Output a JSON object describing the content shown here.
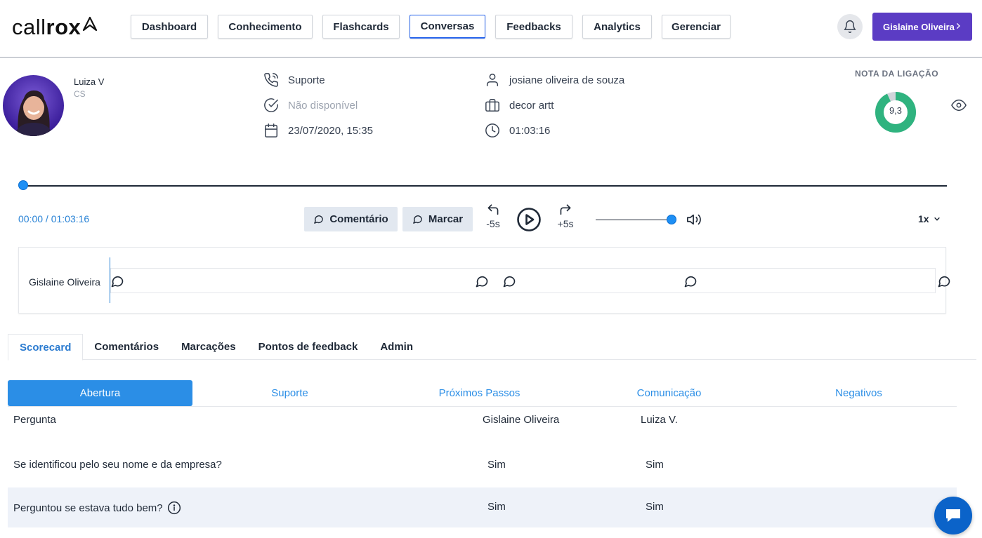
{
  "brand": {
    "logo_part1": "call",
    "logo_part2": "rox"
  },
  "nav": {
    "items": [
      {
        "label": "Dashboard",
        "width": 110,
        "active": false
      },
      {
        "label": "Conhecimento",
        "width": 135,
        "active": false
      },
      {
        "label": "Flashcards",
        "width": 110,
        "active": false
      },
      {
        "label": "Conversas",
        "width": 108,
        "active": true
      },
      {
        "label": "Feedbacks",
        "width": 110,
        "active": false
      },
      {
        "label": "Analytics",
        "width": 99,
        "active": false
      },
      {
        "label": "Gerenciar",
        "width": 98,
        "active": false
      }
    ]
  },
  "header": {
    "user_label": "Gislaine Oliveira"
  },
  "call": {
    "agent_name": "Luiza V",
    "agent_role": "CS",
    "queue": "Suporte",
    "status": "Não disponível",
    "datetime": "23/07/2020, 15:35",
    "customer": "josiane oliveira de souza",
    "company": "decor artt",
    "duration": "01:03:16",
    "score_label": "NOTA DA LIGAÇÃO",
    "score": "9,3",
    "score_fraction": 0.93
  },
  "player": {
    "time": "00:00 / 01:03:16",
    "comment_label": "Comentário",
    "mark_label": "Marcar",
    "back_label": "-5s",
    "forward_label": "+5s",
    "speed": "1x",
    "volume_fraction": 1.0,
    "progress_fraction": 0.0
  },
  "track": {
    "speaker": "Gislaine Oliveira",
    "comment_markers": [
      0.0,
      0.441,
      0.474,
      0.693,
      1.0
    ]
  },
  "tabs": {
    "items": [
      {
        "label": "Scorecard",
        "active": true
      },
      {
        "label": "Comentários",
        "active": false
      },
      {
        "label": "Marcações",
        "active": false
      },
      {
        "label": "Pontos de feedback",
        "active": false
      },
      {
        "label": "Admin",
        "active": false
      }
    ]
  },
  "scorecard": {
    "sections": [
      {
        "label": "Abertura",
        "active": true
      },
      {
        "label": "Suporte",
        "active": false
      },
      {
        "label": "Próximos Passos",
        "active": false
      },
      {
        "label": "Comunicação",
        "active": false
      },
      {
        "label": "Negativos",
        "active": false
      }
    ],
    "columns": {
      "question": "Pergunta",
      "evaluator": "Gislaine Oliveira",
      "agent": "Luiza V."
    },
    "rows": [
      {
        "question": "Se identificou pelo seu nome e da empresa?",
        "evaluator": "Sim",
        "agent": "Sim",
        "info": false
      },
      {
        "question": "Perguntou se estava tudo bem?",
        "evaluator": "Sim",
        "agent": "Sim",
        "info": true
      }
    ]
  },
  "colors": {
    "brand": "#5b3cc4",
    "accent": "#2b8ee6",
    "score": "#2fb37f"
  }
}
